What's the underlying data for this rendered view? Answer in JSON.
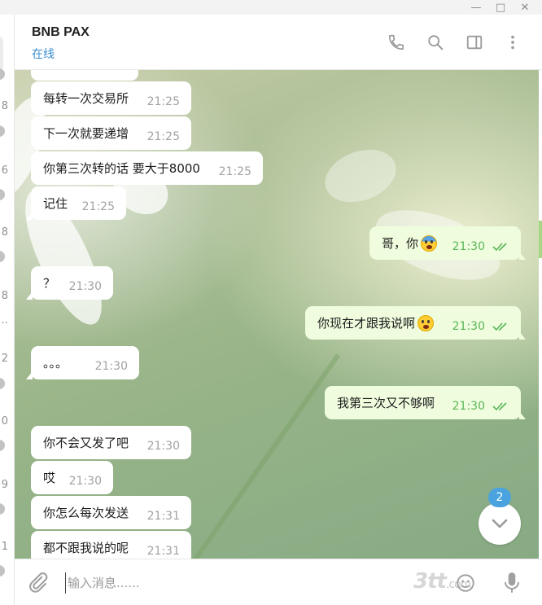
{
  "window": {
    "minimize_glyph": "—",
    "maximize_glyph": "□",
    "close_glyph": "✕"
  },
  "sidebar": {
    "partial_items": [
      "",
      "8",
      "6",
      "8",
      "8",
      "…",
      "2",
      "0",
      "9",
      "1"
    ]
  },
  "header": {
    "peer_name": "BNB PAX",
    "status": "在线",
    "icons": [
      "phone-icon",
      "search-icon",
      "sidebar-toggle-icon",
      "more-vertical-icon"
    ]
  },
  "messages": [
    {
      "direction": "in",
      "text": "每转一次交易所",
      "time": "21:25"
    },
    {
      "direction": "in",
      "text": "下一次就要递增",
      "time": "21:25"
    },
    {
      "direction": "in",
      "text": "你第三次转的话 要大于8000",
      "time": "21:25"
    },
    {
      "direction": "in",
      "text": "记住",
      "time": "21:25"
    },
    {
      "direction": "out",
      "text": "哥，你",
      "emoji": "scream-emoji",
      "time": "21:30",
      "status": "read"
    },
    {
      "direction": "in",
      "text": "？",
      "time": "21:30"
    },
    {
      "direction": "out",
      "text": "你现在才跟我说啊",
      "emoji": "crying-emoji",
      "time": "21:30",
      "status": "read"
    },
    {
      "direction": "in",
      "text": "。。。",
      "time": "21:30"
    },
    {
      "direction": "out",
      "text": "我第三次又不够啊",
      "time": "21:30",
      "status": "read"
    },
    {
      "direction": "in",
      "text": "你不会又发了吧",
      "time": "21:30"
    },
    {
      "direction": "in",
      "text": "哎",
      "time": "21:30"
    },
    {
      "direction": "in",
      "text": "你怎么每次发送",
      "time": "21:31"
    },
    {
      "direction": "in",
      "text": "都不跟我说的呢",
      "time": "21:31"
    }
  ],
  "scroll_down": {
    "unread_count": "2"
  },
  "composer": {
    "placeholder": "输入消息......",
    "value": "",
    "icons": [
      "attach-icon",
      "emoji-icon",
      "microphone-icon"
    ]
  },
  "watermark": {
    "text": "3tt",
    "suffix": ".com"
  },
  "colors": {
    "accent": "#3a8fd0",
    "incoming_bubble": "#ffffff",
    "outgoing_bubble": "#effdde",
    "read_ticks": "#59b558",
    "badge": "#4aa3df"
  }
}
